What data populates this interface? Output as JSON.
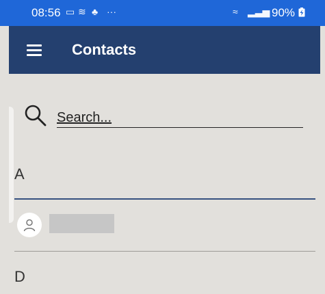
{
  "status_bar": {
    "time": "08:56",
    "icons": [
      "image-icon",
      "wifi-calling-icon",
      "tree-icon",
      "more-icon"
    ],
    "right_icons": [
      "wifi-signal-icon",
      "cellular-signal-icon"
    ],
    "battery": "90%"
  },
  "app_bar": {
    "title": "Contacts",
    "menu_icon": "hamburger-menu-icon"
  },
  "search": {
    "placeholder": "Search..."
  },
  "sections": [
    {
      "letter": "A",
      "contacts": [
        {
          "name": "",
          "avatar": "person-outline-icon"
        }
      ]
    },
    {
      "letter": "D"
    }
  ],
  "colors": {
    "status_bar": "#1f67d8",
    "app_bar": "#24406f",
    "background": "#e2e0dc"
  }
}
